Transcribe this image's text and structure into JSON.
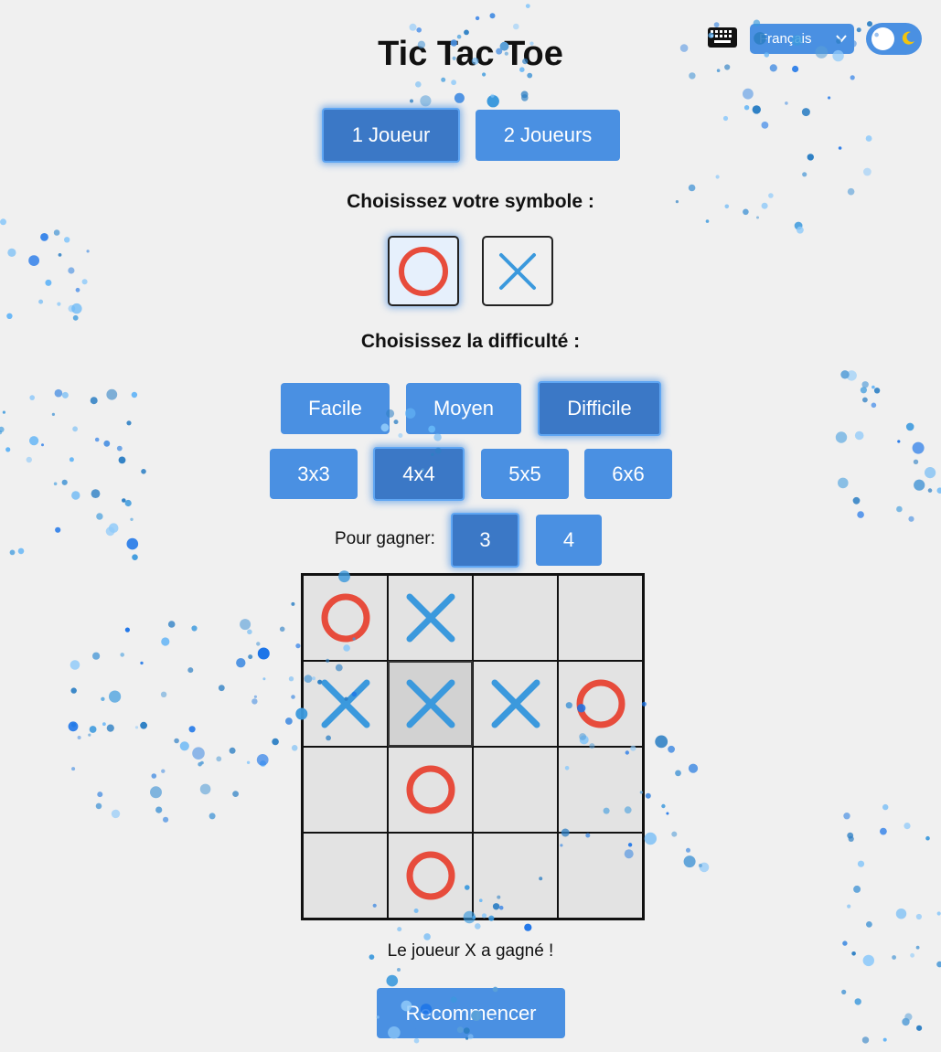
{
  "header": {
    "title": "Tic Tac Toe",
    "language": "Français",
    "icons": [
      "keyboard-icon",
      "chevron-down-icon",
      "moon-icon"
    ]
  },
  "mode": {
    "options": [
      "1 Joueur",
      "2 Joueurs"
    ],
    "selected": "1 Joueur"
  },
  "symbol": {
    "label": "Choisissez votre symbole :",
    "options": [
      "O",
      "X"
    ],
    "selected": "O"
  },
  "difficulty": {
    "label": "Choisissez la difficulté :",
    "options": [
      "Facile",
      "Moyen",
      "Difficile"
    ],
    "selected": "Difficile"
  },
  "size": {
    "options": [
      "3x3",
      "4x4",
      "5x5",
      "6x6"
    ],
    "selected": "4x4"
  },
  "win": {
    "label": "Pour gagner:",
    "options": [
      "3",
      "4"
    ],
    "selected": "3"
  },
  "board": {
    "cells": [
      [
        "O",
        "X",
        "",
        ""
      ],
      [
        "X",
        "X",
        "X",
        "O"
      ],
      [
        "",
        "O",
        "",
        ""
      ],
      [
        "",
        "O",
        "",
        ""
      ]
    ],
    "highlighted": [
      1,
      1
    ]
  },
  "status": "Le joueur X a gagné !",
  "restart_label": "Recommencer",
  "colors": {
    "accent": "#4a90e2",
    "accent_active": "#3b78c6",
    "o_mark": "#e74c3c",
    "x_mark": "#3b99dd",
    "background": "#f0f0f0"
  }
}
